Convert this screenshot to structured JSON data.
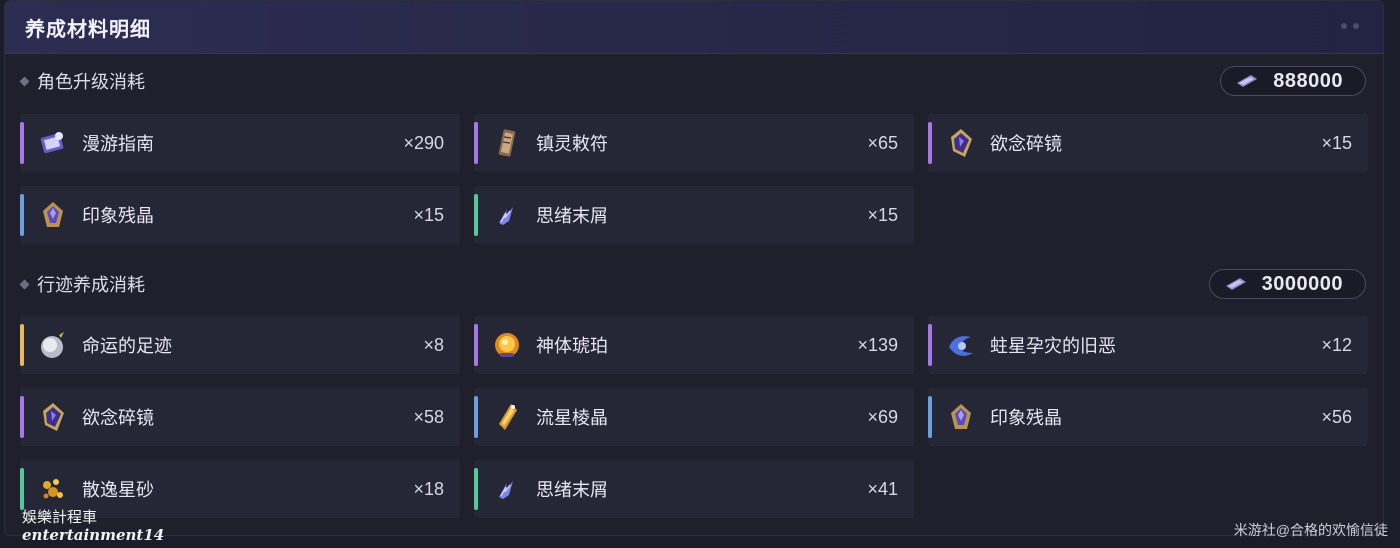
{
  "panel": {
    "title": "养成材料明细"
  },
  "sections": [
    {
      "title": "角色升级消耗",
      "cost": "888000",
      "items": [
        {
          "name": "漫游指南",
          "qty": "×290",
          "bar": "#a679e8",
          "icon": "guide-book-icon"
        },
        {
          "name": "镇灵敕符",
          "qty": "×65",
          "bar": "#a679e8",
          "icon": "talisman-icon"
        },
        {
          "name": "欲念碎镜",
          "qty": "×15",
          "bar": "#a679e8",
          "icon": "shattered-mirror-icon"
        },
        {
          "name": "印象残晶",
          "qty": "×15",
          "bar": "#6c9fe0",
          "icon": "crystal-shard-icon"
        },
        {
          "name": "思绪末屑",
          "qty": "×15",
          "bar": "#52c9a0",
          "icon": "thought-fragment-icon"
        }
      ]
    },
    {
      "title": "行迹养成消耗",
      "cost": "3000000",
      "items": [
        {
          "name": "命运的足迹",
          "qty": "×8",
          "bar": "#e8b85a",
          "icon": "footprint-orb-icon"
        },
        {
          "name": "神体琥珀",
          "qty": "×139",
          "bar": "#a679e8",
          "icon": "amber-icon"
        },
        {
          "name": "蛀星孕灾的旧恶",
          "qty": "×12",
          "bar": "#a679e8",
          "icon": "cosmic-evil-icon"
        },
        {
          "name": "欲念碎镜",
          "qty": "×58",
          "bar": "#a679e8",
          "icon": "shattered-mirror-icon"
        },
        {
          "name": "流星棱晶",
          "qty": "×69",
          "bar": "#6c9fe0",
          "icon": "meteor-prism-icon"
        },
        {
          "name": "印象残晶",
          "qty": "×56",
          "bar": "#6c9fe0",
          "icon": "crystal-shard-icon"
        },
        {
          "name": "散逸星砂",
          "qty": "×18",
          "bar": "#52c9a0",
          "icon": "star-sand-icon"
        },
        {
          "name": "思绪末屑",
          "qty": "×41",
          "bar": "#52c9a0",
          "icon": "thought-fragment-icon"
        }
      ]
    }
  ],
  "watermarks": {
    "left_line1": "娛樂計程車",
    "left_line2": "entertainment14",
    "right": "米游社@合格的欢愉信徒"
  }
}
